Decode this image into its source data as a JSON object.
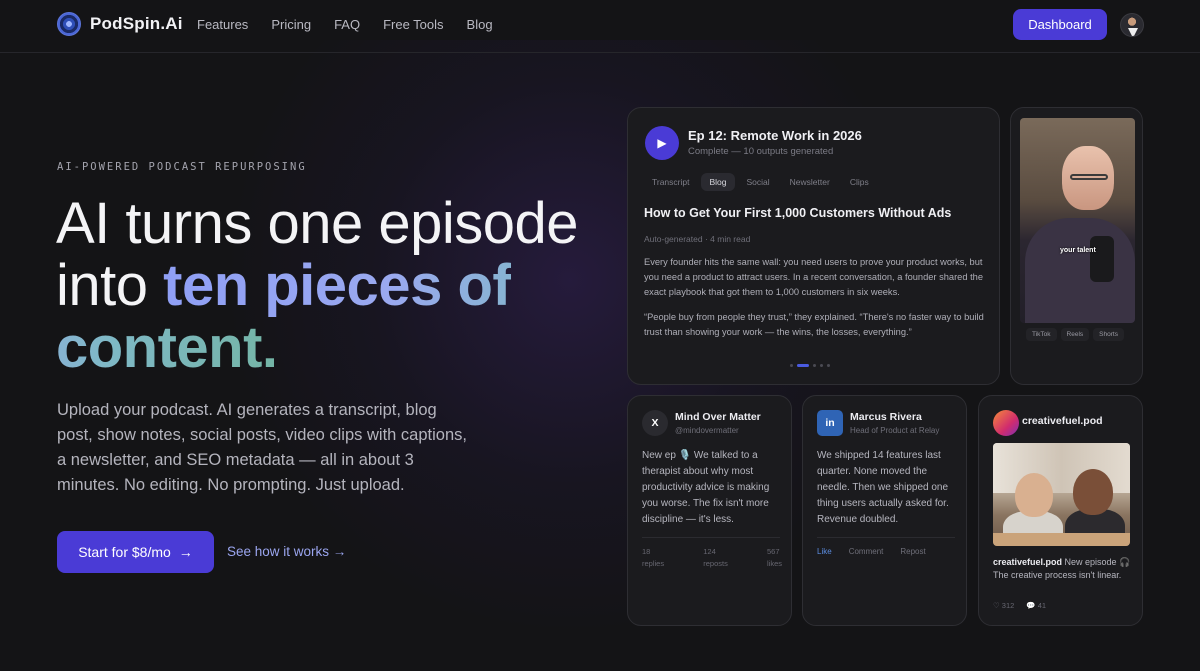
{
  "nav": {
    "brand": "PodSpin.Ai",
    "menu": [
      "Features",
      "Pricing",
      "FAQ",
      "Free Tools",
      "Blog"
    ],
    "dashboard_label": "Dashboard"
  },
  "hero": {
    "eyebrow": "AI-POWERED PODCAST REPURPOSING",
    "headline_plain": "AI turns one episode into ",
    "headline_accent": "ten pieces of content.",
    "subtext": "Upload your podcast. AI generates a transcript, blog post, show notes, social posts, video clips with captions, a newsletter, and SEO metadata — all in about 3 minutes. No editing. No prompting. Just upload.",
    "cta_label": "Start for $8/mo",
    "cta_arrow": "→",
    "secondary_label": "See how it works →"
  },
  "episode_card": {
    "title": "Ep 12: Remote Work in 2026",
    "status": "Complete — 10 outputs generated",
    "tabs": [
      "Transcript",
      "Blog",
      "Social",
      "Newsletter",
      "Clips"
    ],
    "active_tab": "Blog",
    "post_title": "How to Get Your First 1,000 Customers Without Ads",
    "post_meta": "Auto-generated · 4 min read",
    "paragraph1": "Every founder hits the same wall: you need users to prove your product works, but you need a product to attract users. In a recent conversation, a founder shared the exact playbook that got them to 1,000 customers in six weeks.",
    "paragraph2": "“People buy from people they trust,” they explained. “There's no faster way to build trust than showing your work — the wins, the losses, everything.”"
  },
  "video_card": {
    "caption": "your talent",
    "tags": [
      "TikTok",
      "Reels",
      "Shorts"
    ]
  },
  "x_card": {
    "badge": "X",
    "name": "Mind Over Matter",
    "handle": "@mindovermatter",
    "body": "New ep 🎙️ We talked to a therapist about why most productivity advice is making you worse. The fix isn't more discipline — it's less.",
    "stats": [
      {
        "value": "18",
        "label": "replies"
      },
      {
        "value": "124",
        "label": "reposts"
      },
      {
        "value": "567",
        "label": "likes"
      }
    ]
  },
  "linkedin_card": {
    "badge": "in",
    "name": "Marcus Rivera",
    "handle": "Head of Product at Relay",
    "body": "We shipped 14 features last quarter. None moved the needle. Then we shipped one thing users actually asked for. Revenue doubled.",
    "actions": [
      "Like",
      "Comment",
      "Repost"
    ]
  },
  "instagram_card": {
    "name": "creativefuel.pod",
    "caption_user": "creativefuel.pod",
    "caption_text": " New episode 🎧 The creative process isn't linear.",
    "likes": "♡ 312",
    "comments": "💬 41"
  },
  "colors": {
    "accent": "#4a3bd6",
    "background": "#141416",
    "card": "#1b1b1e"
  }
}
